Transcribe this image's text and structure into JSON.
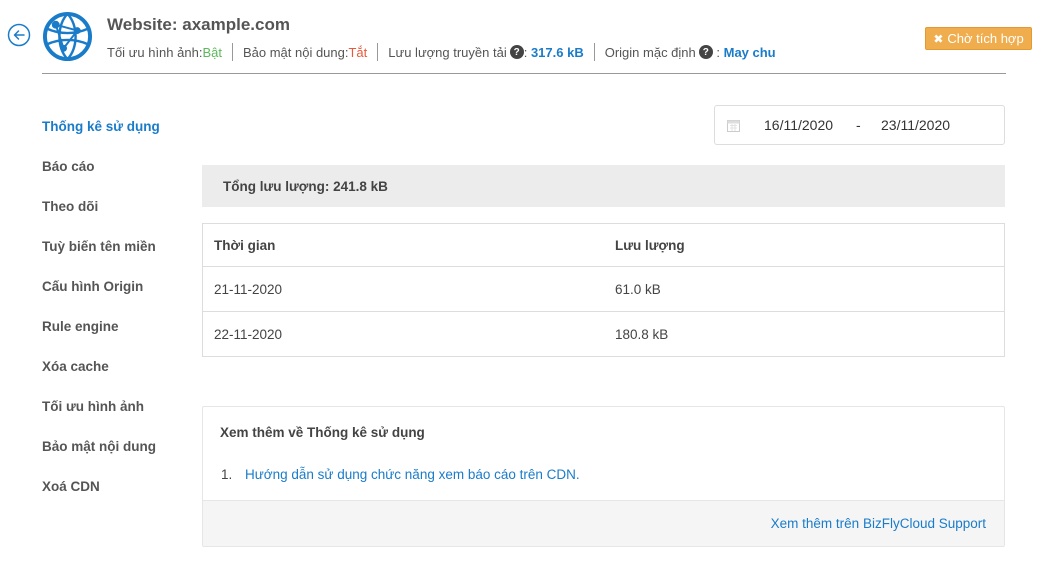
{
  "header": {
    "title": "Website: axample.com",
    "meta": {
      "image_opt_label": "Tối ưu hình ảnh: ",
      "image_opt_value": "Bật",
      "content_security_label": "Bảo mật nội dung: ",
      "content_security_value": "Tắt",
      "bandwidth_label": "Lưu lượng truyền tải ",
      "bandwidth_value": "317.6 kB",
      "origin_label": "Origin mặc định ",
      "origin_value": "May chu"
    },
    "status_button": "Chờ tích hợp",
    "colors": {
      "accent": "#1a7cc9",
      "on": "#5cb85c",
      "off": "#e8593c",
      "warning": "#f0ad4e"
    }
  },
  "sidebar": {
    "items": [
      {
        "label": "Thống kê sử dụng",
        "active": true
      },
      {
        "label": "Báo cáo"
      },
      {
        "label": "Theo dõi"
      },
      {
        "label": "Tuỳ biến tên miền"
      },
      {
        "label": "Cấu hình Origin"
      },
      {
        "label": "Rule engine"
      },
      {
        "label": "Xóa cache"
      },
      {
        "label": "Tối ưu hình ảnh"
      },
      {
        "label": "Bảo mật nội dung"
      },
      {
        "label": "Xoá CDN"
      }
    ]
  },
  "date_range": {
    "start": "16/11/2020",
    "separator": "-",
    "end": "23/11/2020",
    "icon": "calendar-icon"
  },
  "total": {
    "text": "Tổng lưu lượng: 241.8 kB"
  },
  "table": {
    "columns": [
      "Thời gian",
      "Lưu lượng"
    ],
    "rows": [
      [
        "21-11-2020",
        "61.0 kB"
      ],
      [
        "22-11-2020",
        "180.8 kB"
      ]
    ]
  },
  "info": {
    "title": "Xem thêm về Thống kê sử dụng",
    "items": [
      {
        "num": "1.",
        "label": "Hướng dẫn sử dụng chức năng xem báo cáo trên CDN."
      }
    ],
    "footer_link": "Xem thêm trên BizFlyCloud Support"
  }
}
